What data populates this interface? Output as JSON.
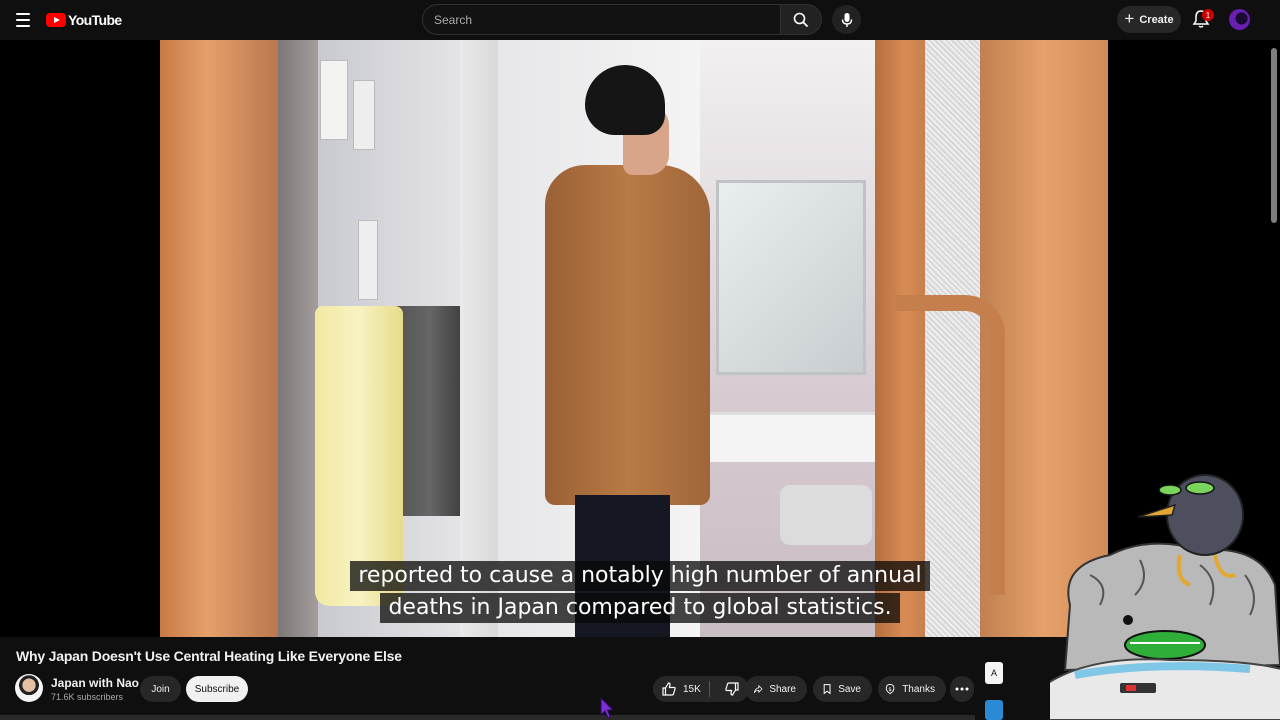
{
  "masthead": {
    "logo_text": "YouTube",
    "search_placeholder": "Search",
    "create_label": "Create",
    "notification_count": "1"
  },
  "player": {
    "caption_lines": [
      "reported to cause a notably high number of annual",
      "deaths in Japan compared to global statistics."
    ]
  },
  "video": {
    "title": "Why Japan Doesn't Use Central Heating Like Everyone Else",
    "channel_name": "Japan with Nao",
    "subscribers": "71.6K subscribers",
    "join_label": "Join",
    "subscribe_label": "Subscribe",
    "like_count": "15K",
    "share_label": "Share",
    "save_label": "Save",
    "thanks_label": "Thanks"
  },
  "side": {
    "label": "A"
  },
  "colors": {
    "brand_red": "#ff0000",
    "background": "#0f0f0f",
    "pill": "#272727",
    "cursor": "#7b2fd6"
  }
}
